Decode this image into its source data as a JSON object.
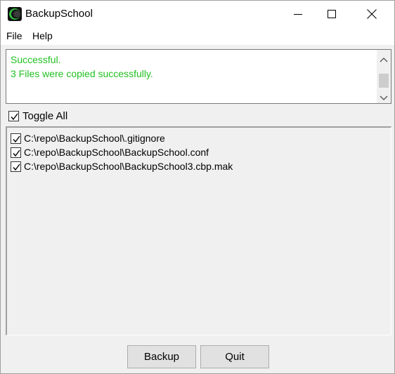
{
  "window": {
    "title": "BackupSchool",
    "controls": [
      "minimize-icon",
      "maximize-icon",
      "close-icon"
    ]
  },
  "menu": {
    "file": "File",
    "help": "Help"
  },
  "status": {
    "line1": "Successful.",
    "line2": "3 Files were copied successfully.",
    "color": "#22c022"
  },
  "toggle_all": {
    "label": "Toggle All",
    "checked": true
  },
  "files": [
    {
      "path": "C:\\repo\\BackupSchool\\.gitignore",
      "checked": true
    },
    {
      "path": "C:\\repo\\BackupSchool\\BackupSchool.conf",
      "checked": true
    },
    {
      "path": "C:\\repo\\BackupSchool\\BackupSchool3.cbp.mak",
      "checked": true
    }
  ],
  "buttons": {
    "backup": "Backup",
    "quit": "Quit"
  }
}
